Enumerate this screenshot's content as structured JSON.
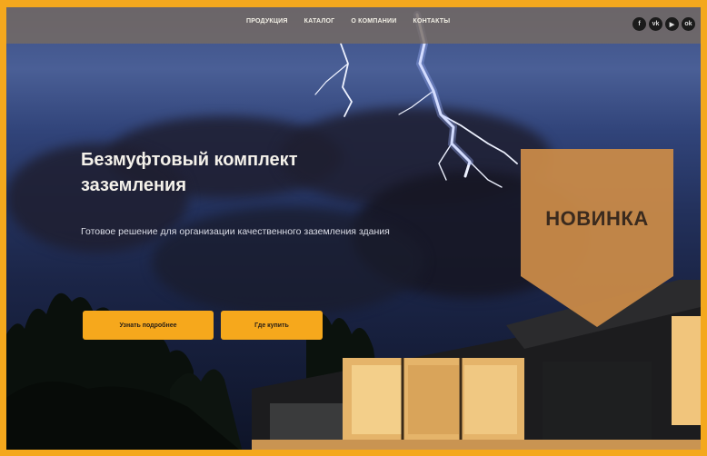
{
  "nav": {
    "items": [
      "ПРОДУКЦИЯ",
      "КАТАЛОГ",
      "О КОМПАНИИ",
      "КОНТАКТЫ"
    ]
  },
  "social": [
    {
      "icon": "facebook-icon",
      "glyph": "f"
    },
    {
      "icon": "vk-icon",
      "glyph": "vk"
    },
    {
      "icon": "youtube-icon",
      "glyph": "▶"
    },
    {
      "icon": "ok-icon",
      "glyph": "ok"
    }
  ],
  "hero": {
    "title": "Безмуфтовый комплект заземления",
    "subtitle": "Готовое решение для организации качественного заземления здания"
  },
  "buttons": {
    "primary": "Узнать подробнее",
    "secondary": "Где купить"
  },
  "badge": {
    "label": "НОВИНКА"
  },
  "colors": {
    "accent": "#f6a81c",
    "badge": "#c98a48",
    "frame": "#f4a81d"
  }
}
